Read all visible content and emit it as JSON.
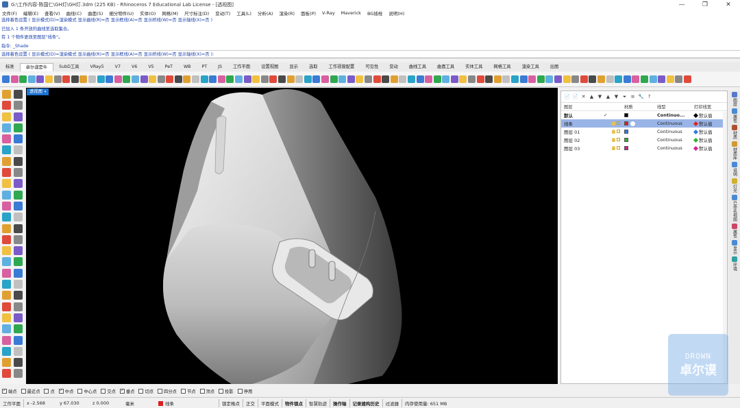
{
  "window": {
    "title": "G:\\工作内容-陈国仁\\GH灯\\GH灯.3dm (225 KB) - Rhinoceros 7 Educational Lab License - [透视图]",
    "controls": [
      "—",
      "❐",
      "✕"
    ]
  },
  "menu": [
    "文件(F)",
    "编辑(E)",
    "查看(V)",
    "曲线(C)",
    "曲面(S)",
    "细分物件(U)",
    "实体(O)",
    "网格(M)",
    "尺寸标注(D)",
    "变动(T)",
    "工具(L)",
    "分析(A)",
    "渲染(R)",
    "面板(P)",
    "V-Ray",
    "Maverick",
    "BG插栓",
    "说明(H)"
  ],
  "command_history": [
    "选择着色设置 ( 显示模式(D)=渲染模式  显示曲线(R)=否  显示框线(A)=否  显示桥线(W)=否  显示轴线(X)=否 )",
    "已加入 1 条开放的曲线至选取集合。",
    "有 1 个物件更改至图层\"线条\"。",
    "指令: _Shade"
  ],
  "command_prompt": "选择着色设置 ( 显示模式(D)=渲染模式  显示曲线(R)=否  显示框线(A)=否  显示桥线(W)=否  显示轴线(X)=否 ):",
  "toolbar_tabs": {
    "items": [
      "标准",
      "卓尔谟是牛",
      "SubD工具",
      "VRay5",
      "V7",
      "V6",
      "V5",
      "PeT",
      "WB",
      "PT",
      "JS",
      "工作平面",
      "设置视图",
      "显示",
      "选取",
      "工作视窗配置",
      "可见性",
      "变动",
      "曲线工具",
      "曲面工具",
      "实体工具",
      "网格工具",
      "渲染工具",
      "出图"
    ],
    "active_index": 1
  },
  "viewport": {
    "label": "透视图",
    "caret": "▾"
  },
  "layers_panel": {
    "toolbar_icons": [
      "📄",
      "📄",
      "✕",
      "▲",
      "▼",
      "▲",
      "▼",
      "⏷",
      "≡",
      "🔧",
      "?"
    ],
    "columns": [
      "图层",
      "",
      "材质",
      "线型",
      "打印线宽"
    ],
    "rows": [
      {
        "name": "默认",
        "current": "✓",
        "color": "#000000",
        "linetype": "Continuo...",
        "print_color": "#000000",
        "print_width": "默认值",
        "bold": true,
        "selected": false
      },
      {
        "name": "线条",
        "current": "",
        "color": "#e02020",
        "linetype": "Continuous",
        "print_color": "#e02020",
        "print_width": "默认值",
        "bold": false,
        "selected": true
      },
      {
        "name": "图层 01",
        "current": "",
        "color": "#2a7de0",
        "linetype": "Continuous",
        "print_color": "#2a7de0",
        "print_width": "默认值",
        "bold": false,
        "selected": false
      },
      {
        "name": "图层 02",
        "current": "",
        "color": "#30b030",
        "linetype": "Continuous",
        "print_color": "#30b030",
        "print_width": "默认值",
        "bold": false,
        "selected": false
      },
      {
        "name": "图层 03",
        "current": "",
        "color": "#d02090",
        "linetype": "Continuous",
        "print_color": "#d02090",
        "print_width": "默认值",
        "bold": false,
        "selected": false
      }
    ]
  },
  "right_tabs": [
    {
      "label": "图层",
      "color": "#5577cc"
    },
    {
      "label": "属性",
      "color": "#4a8ad4"
    },
    {
      "label": "材质",
      "color": "#b05030"
    },
    {
      "label": "材质库",
      "color": "#d09a30"
    },
    {
      "label": "说明",
      "color": "#4a8ad4"
    },
    {
      "label": "灯光",
      "color": "#d0b030"
    },
    {
      "label": "已命名视图",
      "color": "#4a8ad4"
    },
    {
      "label": "属性",
      "color": "#cc4466"
    },
    {
      "label": "显示",
      "color": "#4a8ad4"
    },
    {
      "label": "环境",
      "color": "#30a0a0"
    }
  ],
  "osnaps": [
    {
      "label": "端点",
      "checked": true
    },
    {
      "label": "最近点",
      "checked": false
    },
    {
      "label": "点",
      "checked": false
    },
    {
      "label": "中点",
      "checked": true
    },
    {
      "label": "中心点",
      "checked": false
    },
    {
      "label": "交点",
      "checked": false
    },
    {
      "label": "垂点",
      "checked": true
    },
    {
      "label": "切点",
      "checked": false
    },
    {
      "label": "四分点",
      "checked": false
    },
    {
      "label": "节点",
      "checked": false
    },
    {
      "label": "顶点",
      "checked": false
    },
    {
      "label": "投影",
      "checked": false
    },
    {
      "label": "停用",
      "checked": false
    }
  ],
  "status": {
    "cplane": "工作平面",
    "x": "x -2.568",
    "y": "y 67.030",
    "z": "z 0.000",
    "unit": "毫米",
    "layer": "线条",
    "layer_color": "#d91f1f",
    "toggles": [
      {
        "label": "锁定格点",
        "bold": false
      },
      {
        "label": "正交",
        "bold": false
      },
      {
        "label": "平面模式",
        "bold": false
      },
      {
        "label": "物件锁点",
        "bold": true
      },
      {
        "label": "智慧轨迹",
        "bold": false
      },
      {
        "label": "操作轴",
        "bold": true
      },
      {
        "label": "记录建构历史",
        "bold": true
      },
      {
        "label": "过滤器",
        "bold": false
      },
      {
        "label": "内存使用量: 651 MB",
        "bold": false
      }
    ]
  },
  "watermark": {
    "line1": "DROWN",
    "line2": "卓尔谟"
  },
  "colors": {
    "selection": "#99b4e6",
    "viewport_label": "#1e73d2",
    "command_text": "#1a3faa"
  }
}
